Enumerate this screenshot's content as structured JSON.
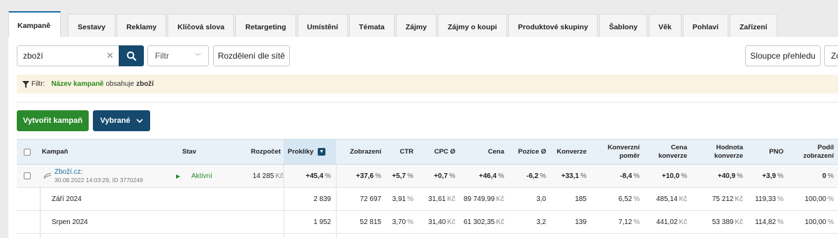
{
  "tabs": [
    "Kampaně",
    "Sestavy",
    "Reklamy",
    "Klíčová slova",
    "Retargeting",
    "Umístění",
    "Témata",
    "Zájmy",
    "Zájmy o koupi",
    "Produktové skupiny",
    "Šablony",
    "Věk",
    "Pohlaví",
    "Zařízení"
  ],
  "toolbar": {
    "search_value": "zboží",
    "filter_placeholder": "Filtr",
    "split_label": "Rozdělení dle sítě",
    "columns_label": "Sloupce přehledu",
    "cut_label": "Zo"
  },
  "filter_banner": {
    "prefix": "Filtr:",
    "field": "Název kampaně",
    "operator": "obsahuje",
    "value": "zboží"
  },
  "actions": {
    "create": "Vytvořit kampaň",
    "selected": "Vybrané"
  },
  "table": {
    "headers": {
      "campaign": "Kampaň",
      "status": "Stav",
      "budget": "Rozpočet",
      "clicks": "Prokliky",
      "impressions": "Zobrazení",
      "ctr": "CTR",
      "cpc": "CPC Ø",
      "cost": "Cena",
      "position": "Pozice Ø",
      "conversions": "Konverze",
      "conv_rate": "Konverzní poměr",
      "conv_cost": "Cena konverze",
      "conv_value": "Hodnota konverze",
      "pno": "PNO",
      "imp_share": "Podíl zobrazení"
    },
    "campaign_row": {
      "name": "Zboží.cz:",
      "meta": "30.08.2022 14:03:29, ID 3770249",
      "status": "Aktivní",
      "budget": "14 285",
      "budget_unit": "Kč",
      "clicks": "+45,4",
      "impressions": "+37,6",
      "ctr": "+5,7",
      "cpc": "+0,7",
      "cost": "+46,4",
      "position": "-6,2",
      "conversions": "+33,1",
      "conv_rate": "-8,4",
      "conv_cost": "+10,0",
      "conv_value": "+40,9",
      "pno": "+3,9",
      "imp_share": "0",
      "pct": "%"
    },
    "months": [
      {
        "label": "Září 2024",
        "clicks": "2 839",
        "impressions": "72 697",
        "ctr": "3,91",
        "cpc": "31,61",
        "cost": "89 749,99",
        "position": "3,0",
        "conversions": "185",
        "conv_rate": "6,52",
        "conv_cost": "485,14",
        "conv_value": "75 212",
        "pno": "119,33",
        "imp_share": "100,00"
      },
      {
        "label": "Srpen 2024",
        "clicks": "1 952",
        "impressions": "52 815",
        "ctr": "3,70",
        "cpc": "31,40",
        "cost": "61 302,35",
        "position": "3,2",
        "conversions": "139",
        "conv_rate": "7,12",
        "conv_cost": "441,02",
        "conv_value": "53 389",
        "pno": "114,82",
        "imp_share": "100,00"
      }
    ],
    "units": {
      "kc": "Kč",
      "pct": "%"
    }
  }
}
